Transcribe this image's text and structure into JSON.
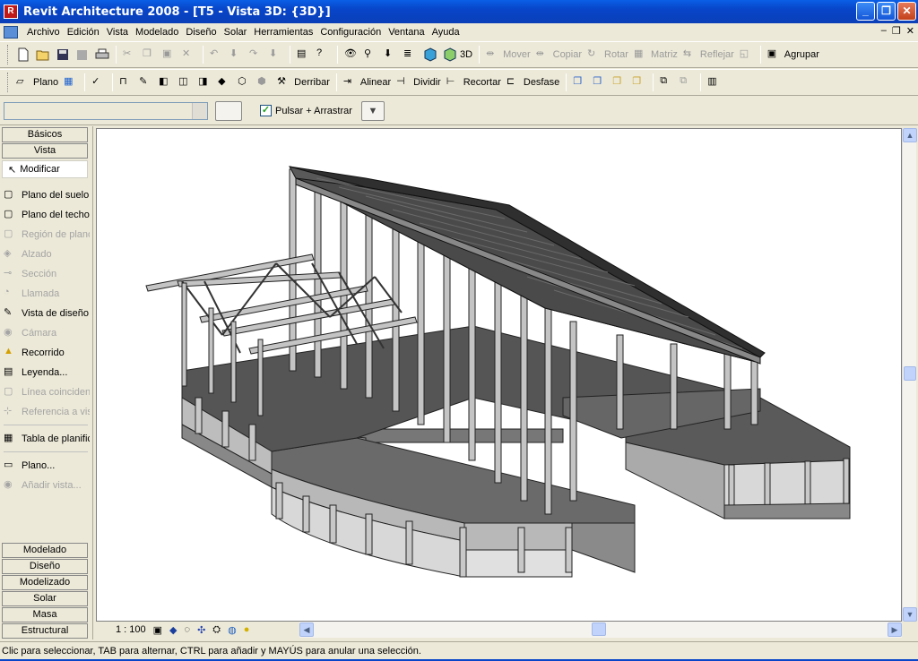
{
  "window": {
    "title": "Revit Architecture 2008 - [T5 - Vista 3D: {3D}]",
    "app_icon_letter": "R"
  },
  "menu": [
    {
      "label": "Archivo"
    },
    {
      "label": "Edición"
    },
    {
      "label": "Vista"
    },
    {
      "label": "Modelado"
    },
    {
      "label": "Diseño"
    },
    {
      "label": "Solar"
    },
    {
      "label": "Herramientas"
    },
    {
      "label": "Configuración"
    },
    {
      "label": "Ventana"
    },
    {
      "label": "Ayuda"
    }
  ],
  "toolbar1": {
    "view3d_label": "3D",
    "mover": "Mover",
    "copiar": "Copiar",
    "rotar": "Rotar",
    "matriz": "Matriz",
    "reflejar": "Reflejar",
    "agrupar": "Agrupar"
  },
  "toolbar2": {
    "plano": "Plano",
    "derribar": "Derribar",
    "alinear": "Alinear",
    "dividir": "Dividir",
    "recortar": "Recortar",
    "desfase": "Desfase"
  },
  "options": {
    "drag_checkbox_label": "Pulsar + Arrastrar",
    "drag_checked": true
  },
  "designbar": {
    "top_tabs": [
      "Básicos",
      "Vista"
    ],
    "active_tool": "Modificar",
    "tools": [
      {
        "label": "Plano del suelo...",
        "enabled": true
      },
      {
        "label": "Plano del techo...",
        "enabled": true
      },
      {
        "label": "Región de plano",
        "enabled": false
      },
      {
        "label": "Alzado",
        "enabled": false
      },
      {
        "label": "Sección",
        "enabled": false
      },
      {
        "label": "Llamada",
        "enabled": false
      },
      {
        "label": "Vista de diseño",
        "enabled": true
      },
      {
        "label": "Cámara",
        "enabled": false
      },
      {
        "label": "Recorrido",
        "enabled": true
      },
      {
        "label": "Leyenda...",
        "enabled": true
      },
      {
        "label": "Línea coincidente",
        "enabled": false
      },
      {
        "label": "Referencia a vista",
        "enabled": false
      }
    ],
    "tools2": [
      {
        "label": "Tabla de planificación",
        "enabled": true
      }
    ],
    "tools3": [
      {
        "label": "Plano...",
        "enabled": true
      },
      {
        "label": "Añadir vista...",
        "enabled": false
      }
    ],
    "bottom_tabs": [
      "Modelado",
      "Diseño",
      "Modelizado",
      "Solar",
      "Masa",
      "Estructural"
    ]
  },
  "view_control": {
    "scale": "1 : 100"
  },
  "status": {
    "text": "Clic para seleccionar, TAB para alternar, CTRL para añadir y MAYÚS para anular una selección."
  }
}
